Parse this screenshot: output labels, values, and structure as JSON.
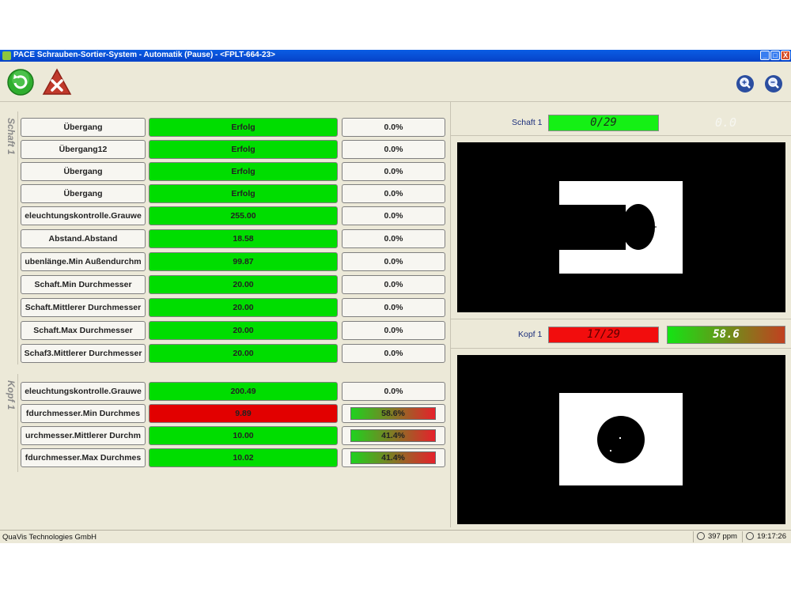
{
  "window": {
    "title": "PACE Schrauben-Sortier-System - Automatik (Pause) - <FPLT-664-23>",
    "controls": [
      "_",
      "□",
      "X"
    ]
  },
  "toolbar": {
    "left_buttons": [
      "refresh-icon",
      "cancel-icon"
    ],
    "right_buttons": [
      "zoom-in-icon",
      "zoom-out-icon"
    ]
  },
  "sections": {
    "schaft_label": "Schaft 1",
    "kopf_label": "Kopf 1"
  },
  "schaft_rows": [
    {
      "name": "Übergang",
      "value": "Erfolg",
      "pct": "0.0%",
      "status": "ok"
    },
    {
      "name": "Übergang12",
      "value": "Erfolg",
      "pct": "0.0%",
      "status": "ok"
    },
    {
      "name": "Übergang",
      "value": "Erfolg",
      "pct": "0.0%",
      "status": "ok"
    },
    {
      "name": "Übergang",
      "value": "Erfolg",
      "pct": "0.0%",
      "status": "ok"
    },
    {
      "name": "eleuchtungskontrolle.Grauwe",
      "value": "255.00",
      "pct": "0.0%",
      "status": "ok"
    },
    {
      "name": "Abstand.Abstand",
      "value": "18.58",
      "pct": "0.0%",
      "status": "ok"
    },
    {
      "name": "ubenlänge.Min Außendurchm",
      "value": "99.87",
      "pct": "0.0%",
      "status": "ok"
    },
    {
      "name": "Schaft.Min Durchmesser",
      "value": "20.00",
      "pct": "0.0%",
      "status": "ok"
    },
    {
      "name": "Schaft.Mittlerer Durchmesser",
      "value": "20.00",
      "pct": "0.0%",
      "status": "ok"
    },
    {
      "name": "Schaft.Max Durchmesser",
      "value": "20.00",
      "pct": "0.0%",
      "status": "ok"
    },
    {
      "name": "Schaf3.Mittlerer Durchmesser",
      "value": "20.00",
      "pct": "0.0%",
      "status": "ok"
    }
  ],
  "kopf_rows": [
    {
      "name": "eleuchtungskontrolle.Grauwe",
      "value": "200.49",
      "pct": "0.0%",
      "status": "ok",
      "pct_bar": false,
      "pct_fraction": 0
    },
    {
      "name": "fdurchmesser.Min Durchmes",
      "value": "9.89",
      "pct": "58.6%",
      "status": "bad",
      "pct_bar": true,
      "pct_fraction": 0.586
    },
    {
      "name": "urchmesser.Mittlerer Durchm",
      "value": "10.00",
      "pct": "41.4%",
      "status": "ok",
      "pct_bar": true,
      "pct_fraction": 0.414
    },
    {
      "name": "fdurchmesser.Max Durchmes",
      "value": "10.02",
      "pct": "41.4%",
      "status": "ok",
      "pct_bar": true,
      "pct_fraction": 0.414
    }
  ],
  "schaft_panel": {
    "label": "Schaft 1",
    "counter": "0/29",
    "faint_value": "0.0"
  },
  "kopf_panel": {
    "label": "Kopf 1",
    "counter": "17/29",
    "value": "58.6"
  },
  "status": {
    "company": "QuaVis Technologies GmbH",
    "rate": "397 ppm",
    "time": "19:17:26"
  },
  "colors": {
    "ok": "#00dd00",
    "bad": "#e20000",
    "label_blue": "#1c2f7c"
  }
}
